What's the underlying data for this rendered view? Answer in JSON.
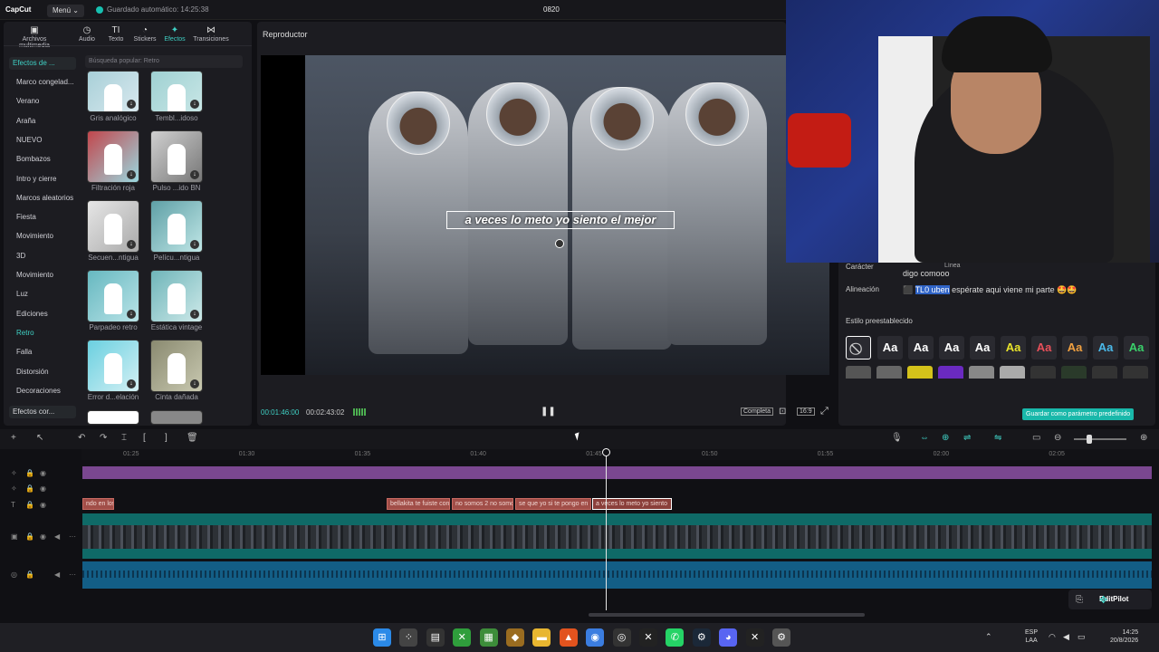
{
  "app": {
    "logo": "CapCut",
    "menu": "Menú ⌄",
    "autosave": "Guardado automático: 14:25:38",
    "project_title": "0820"
  },
  "tabs": [
    {
      "label": "Archivos multimedia",
      "icon": "media-icon",
      "glyph": "▣"
    },
    {
      "label": "Audio",
      "icon": "audio-icon",
      "glyph": "◷"
    },
    {
      "label": "Texto",
      "icon": "text-icon",
      "glyph": "TI"
    },
    {
      "label": "Stickers",
      "icon": "sticker-icon",
      "glyph": "◔"
    },
    {
      "label": "Efectos",
      "icon": "effects-icon",
      "glyph": "✦"
    },
    {
      "label": "Transiciones",
      "icon": "transition-icon",
      "glyph": "⋈"
    }
  ],
  "effects": {
    "category_header": "Efectos de ...",
    "categories": [
      "Marco congelad...",
      "Verano",
      "Araña",
      "NUEVO",
      "Bombazos",
      "Intro y cierre",
      "Marcos aleatorios",
      "Fiesta",
      "Movimiento",
      "3D",
      "Movimiento",
      "Luz",
      "Ediciones",
      "Retro",
      "Falla",
      "Distorsión",
      "Decoraciones"
    ],
    "selected_category": "Retro",
    "category_footer": "Efectos cor...",
    "search_placeholder": "Búsqueda popular: Retro",
    "items": [
      {
        "label": "Gris analógico"
      },
      {
        "label": "Tembl...idoso"
      },
      {
        "label": "Filtración roja"
      },
      {
        "label": "Pulso ...ido BN"
      },
      {
        "label": "Secuen...ntigua"
      },
      {
        "label": "Pelícu...ntigua"
      },
      {
        "label": "Parpadeo retro"
      },
      {
        "label": "Estática vintage"
      },
      {
        "label": "Error d...elación"
      },
      {
        "label": "Cinta dañada"
      }
    ]
  },
  "player": {
    "title": "Reproductor",
    "subtitle": "a veces lo meto yo siento el mejor",
    "time_current": "00:01:46:00",
    "time_total": "00:02:43:02",
    "fullscreen_label": "Completa",
    "ratio_label": "16:9"
  },
  "right": {
    "caracter_label": "Carácter",
    "caracter_value": "digo comooo",
    "linea_label": "Línea",
    "alineacion_label": "Alineación",
    "align_prefix": "⬛",
    "align_highlight": "TL0 uben",
    "align_text": " espérate aqui viene mi parte 🤩🤩",
    "preset_label": "Estilo preestablecido",
    "preset_text": "Aa",
    "save_preset": "Guardar como parámetro predefinido"
  },
  "timeline": {
    "ticks": [
      "01:25",
      "01:30",
      "01:35",
      "01:40",
      "01:45",
      "01:50",
      "01:55",
      "02:00",
      "02:05"
    ],
    "clips": [
      "ndo en los",
      "bellakita te fuiste con",
      "no somos 2 no somo",
      "se que  yo si te pongo en",
      "a veces lo meto yo siento"
    ],
    "editpilot": "EditPilot"
  },
  "taskbar": {
    "lang_top": "ESP",
    "lang_bottom": "LAA",
    "time": "14:25",
    "date": "20/8/2026"
  }
}
